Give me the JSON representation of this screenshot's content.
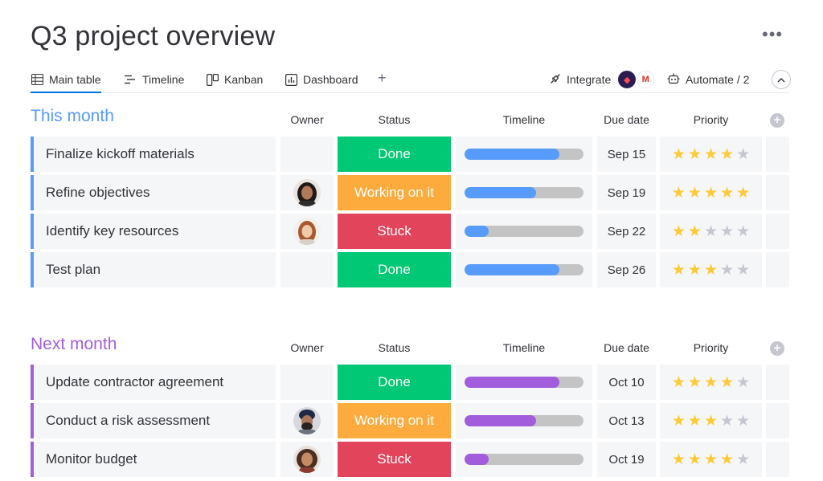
{
  "page": {
    "title": "Q3 project overview"
  },
  "tabs": [
    {
      "label": "Main table",
      "icon": "table-icon",
      "active": true
    },
    {
      "label": "Timeline",
      "icon": "timeline-icon",
      "active": false
    },
    {
      "label": "Kanban",
      "icon": "kanban-icon",
      "active": false
    },
    {
      "label": "Dashboard",
      "icon": "dashboard-icon",
      "active": false
    }
  ],
  "toolbar": {
    "add_tab": "+",
    "integrate_label": "Integrate",
    "automate_label": "Automate / 2",
    "more": "•••"
  },
  "columns": {
    "owner": "Owner",
    "status": "Status",
    "timeline": "Timeline",
    "due_date": "Due date",
    "priority": "Priority"
  },
  "colors": {
    "done": "#00c875",
    "working": "#fdab3d",
    "stuck": "#e2445c",
    "blue": "#579bfc",
    "purple": "#a25ddc",
    "star_on": "#fdc937",
    "star_off": "#c5c7d0"
  },
  "groups": [
    {
      "title": "This month",
      "color": "#579bfc",
      "rows": [
        {
          "name": "Finalize kickoff materials",
          "owner": null,
          "status": "Done",
          "status_key": "done",
          "progress": 0.8,
          "due": "Sep 15",
          "priority": 4
        },
        {
          "name": "Refine objectives",
          "owner": "woman-dark-hair",
          "status": "Working on it",
          "status_key": "working",
          "progress": 0.6,
          "due": "Sep 19",
          "priority": 5
        },
        {
          "name": "Identify key resources",
          "owner": "woman-red-hair",
          "status": "Stuck",
          "status_key": "stuck",
          "progress": 0.2,
          "due": "Sep 22",
          "priority": 2
        },
        {
          "name": "Test plan",
          "owner": null,
          "status": "Done",
          "status_key": "done",
          "progress": 0.8,
          "due": "Sep 26",
          "priority": 3
        }
      ]
    },
    {
      "title": "Next month",
      "color": "#a25ddc",
      "rows": [
        {
          "name": "Update contractor agreement",
          "owner": null,
          "status": "Done",
          "status_key": "done",
          "progress": 0.8,
          "due": "Oct 10",
          "priority": 4
        },
        {
          "name": "Conduct a risk assessment",
          "owner": "man-turban",
          "status": "Working on it",
          "status_key": "working",
          "progress": 0.6,
          "due": "Oct 13",
          "priority": 3
        },
        {
          "name": "Monitor budget",
          "owner": "woman-curly-hair",
          "status": "Stuck",
          "status_key": "stuck",
          "progress": 0.2,
          "due": "Oct 19",
          "priority": 4
        }
      ]
    }
  ]
}
